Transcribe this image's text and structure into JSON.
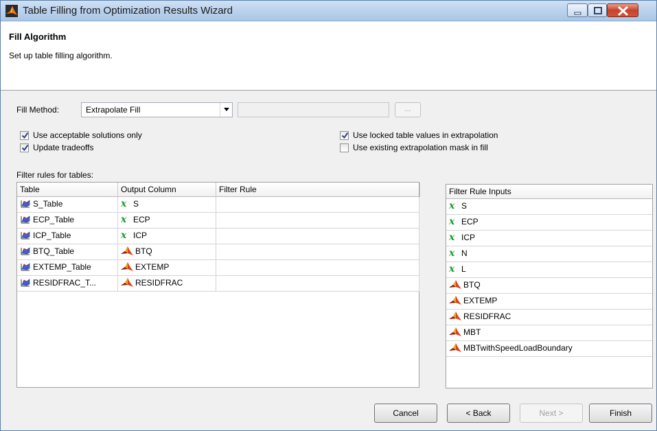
{
  "window": {
    "title": "Table Filling from Optimization Results Wizard"
  },
  "header": {
    "title": "Fill Algorithm",
    "subtitle": "Set up table filling algorithm."
  },
  "fill_method": {
    "label": "Fill Method:",
    "selected": "Extrapolate Fill",
    "browse_label": "..."
  },
  "options": {
    "acceptable_only": {
      "label": "Use acceptable solutions only",
      "checked": true
    },
    "update_tradeoffs": {
      "label": "Update tradeoffs",
      "checked": true
    },
    "locked_values": {
      "label": "Use locked table values in extrapolation",
      "checked": true
    },
    "existing_mask": {
      "label": "Use existing extrapolation mask in fill",
      "checked": false
    }
  },
  "filter_section_label": "Filter rules for tables:",
  "filter_table": {
    "columns": [
      "Table",
      "Output Column",
      "Filter Rule"
    ],
    "rows": [
      {
        "table": "S_Table",
        "output": "S",
        "output_icon": "variable-icon",
        "rule": ""
      },
      {
        "table": "ECP_Table",
        "output": "ECP",
        "output_icon": "variable-icon",
        "rule": ""
      },
      {
        "table": "ICP_Table",
        "output": "ICP",
        "output_icon": "variable-icon",
        "rule": ""
      },
      {
        "table": "BTQ_Table",
        "output": "BTQ",
        "output_icon": "model-icon",
        "rule": ""
      },
      {
        "table": "EXTEMP_Table",
        "output": "EXTEMP",
        "output_icon": "model-icon",
        "rule": ""
      },
      {
        "table": "RESIDFRAC_T...",
        "output": "RESIDFRAC",
        "output_icon": "model-icon",
        "rule": ""
      }
    ]
  },
  "inputs_table": {
    "header": "Filter Rule Inputs",
    "rows": [
      {
        "name": "S",
        "icon": "variable-icon"
      },
      {
        "name": "ECP",
        "icon": "variable-icon"
      },
      {
        "name": "ICP",
        "icon": "variable-icon"
      },
      {
        "name": "N",
        "icon": "variable-icon"
      },
      {
        "name": "L",
        "icon": "variable-icon"
      },
      {
        "name": "BTQ",
        "icon": "model-icon"
      },
      {
        "name": "EXTEMP",
        "icon": "model-icon"
      },
      {
        "name": "RESIDFRAC",
        "icon": "model-icon"
      },
      {
        "name": "MBT",
        "icon": "model-icon"
      },
      {
        "name": "MBTwithSpeedLoadBoundary",
        "icon": "model-icon"
      }
    ]
  },
  "buttons": {
    "cancel": "Cancel",
    "back": "< Back",
    "next": "Next >",
    "finish": "Finish"
  },
  "colors": {
    "variable_icon": "#1f9b2b",
    "model_icon": "#d9441a"
  }
}
